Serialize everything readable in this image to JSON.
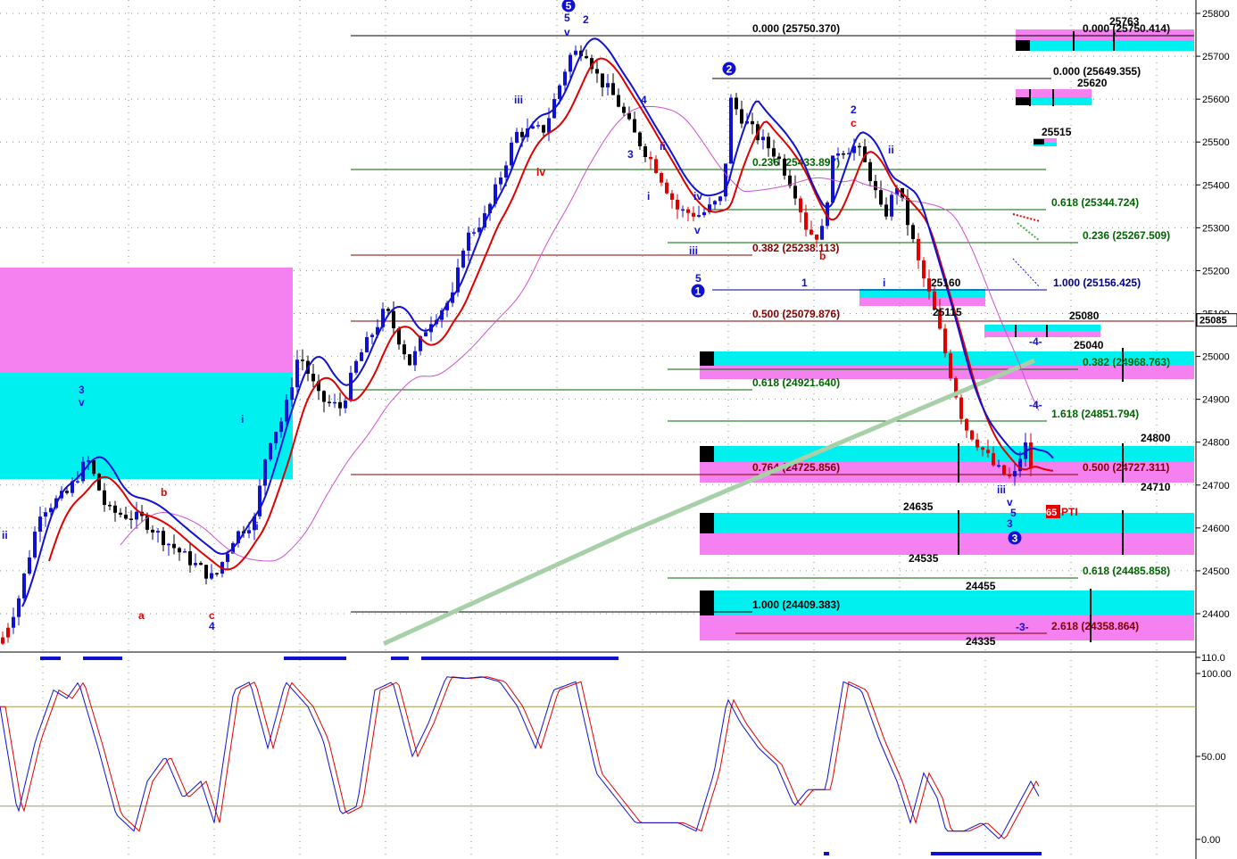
{
  "chart_data": [
    {
      "type": "candlestick",
      "title": "",
      "ylim": [
        24330,
        25820
      ],
      "y_ticks": [
        25800,
        25700,
        25600,
        25500,
        25400,
        25300,
        25200,
        25100,
        25000,
        24900,
        24800,
        24700,
        24600,
        24500,
        24400
      ],
      "last_price_label": "25085",
      "grid": true,
      "series": [
        {
          "name": "",
          "kind": "ma-fast",
          "color": "#e00000"
        },
        {
          "name": "",
          "kind": "ma-band",
          "color": "#1010d0"
        },
        {
          "name": "",
          "kind": "ma-slow",
          "color": "#d050d0"
        },
        {
          "name": "",
          "kind": "ma-long",
          "color": "#a8d0a8"
        }
      ],
      "fib_levels": [
        {
          "label": "0.000 (25750.370)",
          "value": 25750.37,
          "color": "#000000"
        },
        {
          "label": "0.000 (25750.414)",
          "value": 25750.414,
          "color": "#000000"
        },
        {
          "label": "0.000 (25649.355)",
          "value": 25649.355,
          "color": "#000000"
        },
        {
          "label": "0.236 (25433.897)",
          "value": 25433.897,
          "color": "#006400"
        },
        {
          "label": "0.618 (25344.724)",
          "value": 25344.724,
          "color": "#006400"
        },
        {
          "label": "0.236 (25267.509)",
          "value": 25267.509,
          "color": "#006400"
        },
        {
          "label": "0.382 (25238.113)",
          "value": 25238.113,
          "color": "#800000"
        },
        {
          "label": "1.000 (25156.425)",
          "value": 25156.425,
          "color": "#000080"
        },
        {
          "label": "0.500 (25079.876)",
          "value": 25079.876,
          "color": "#800000"
        },
        {
          "label": "0.382 (24968.763)",
          "value": 24968.763,
          "color": "#006400"
        },
        {
          "label": "0.618 (24921.640)",
          "value": 24921.64,
          "color": "#006400"
        },
        {
          "label": "1.618 (24851.794)",
          "value": 24851.794,
          "color": "#006400"
        },
        {
          "label": "0.764 (24725.856)",
          "value": 24725.856,
          "color": "#800000"
        },
        {
          "label": "0.500 (24727.311)",
          "value": 24727.311,
          "color": "#800000"
        },
        {
          "label": "0.618 (24485.858)",
          "value": 24485.858,
          "color": "#006400"
        },
        {
          "label": "1.000 (24409.383)",
          "value": 24409.383,
          "color": "#000000"
        },
        {
          "label": "2.618 (24358.864)",
          "value": 24358.864,
          "color": "#800000"
        }
      ],
      "price_labels": [
        "25763",
        "25620",
        "25515",
        "25160",
        "25115",
        "25080",
        "25040",
        "24800",
        "24710",
        "24635",
        "24535",
        "24455",
        "24335"
      ],
      "wave_labels": [
        "ii",
        "3",
        "v",
        "a",
        "b",
        "c",
        "4",
        "i",
        "ii",
        "iii",
        "iv",
        "5",
        "v",
        "2",
        "4",
        "3",
        "ii",
        "i",
        "iv",
        "iii",
        "v",
        "5",
        "2",
        "c",
        "b",
        "1",
        "i",
        "ii",
        "iii",
        "v",
        "5",
        "3",
        "-4-",
        "-4-",
        "-3-"
      ],
      "circled_labels": [
        "5",
        "2",
        "1",
        "3"
      ],
      "signal_label": "65PTI"
    },
    {
      "type": "line",
      "title": "",
      "ylim": [
        -5,
        110
      ],
      "y_ticks": [
        "110.0",
        "100.00",
        "50.00",
        "0.00"
      ],
      "reference_lines": [
        80,
        20
      ],
      "series": [
        {
          "name": "",
          "color": "#1010d0"
        },
        {
          "name": "",
          "color": "#e00000"
        }
      ]
    }
  ]
}
